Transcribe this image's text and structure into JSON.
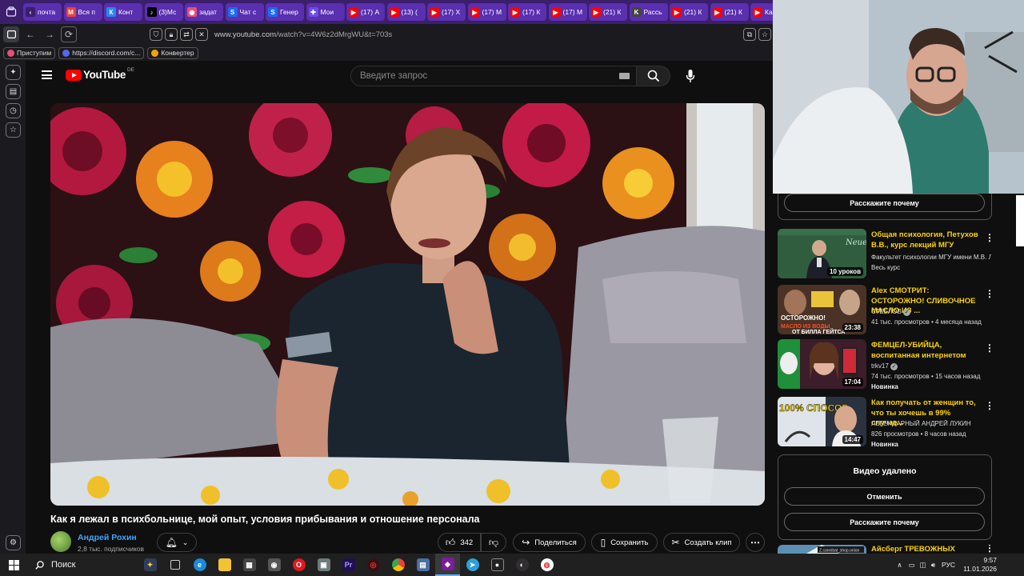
{
  "browser": {
    "tabs": [
      {
        "label": "почта",
        "icon": "chevron-left-icon",
        "color": "#3b1f6b"
      },
      {
        "label": "Вся п",
        "icon": "gmail-icon",
        "color": "#ea4335"
      },
      {
        "label": "Конт",
        "icon": "vk-icon",
        "color": "#2787f5"
      },
      {
        "label": "(3)Мс",
        "icon": "tiktok-icon",
        "color": "#000000"
      },
      {
        "label": "задат",
        "icon": "app-icon",
        "color": "#e94e77"
      },
      {
        "label": "Чат с",
        "icon": "s-icon",
        "color": "#1a6cf0"
      },
      {
        "label": "Генер",
        "icon": "s-icon",
        "color": "#1a6cf0"
      },
      {
        "label": "Мои",
        "icon": "plus-icon",
        "color": "#6b4de6"
      },
      {
        "label": "(17) А",
        "icon": "youtube-icon",
        "color": "#ff0000"
      },
      {
        "label": "(13) (",
        "icon": "youtube-icon",
        "color": "#ff0000"
      },
      {
        "label": "(17) Х",
        "icon": "youtube-icon",
        "color": "#ff0000"
      },
      {
        "label": "(17) М",
        "icon": "youtube-icon",
        "color": "#ff0000"
      },
      {
        "label": "(17) К",
        "icon": "youtube-icon",
        "color": "#ff0000"
      },
      {
        "label": "(17) М",
        "icon": "youtube-icon",
        "color": "#ff0000"
      },
      {
        "label": "(21) К",
        "icon": "youtube-icon",
        "color": "#ff0000"
      },
      {
        "label": "Рассь",
        "icon": "k-icon",
        "color": "#444444"
      },
      {
        "label": "(21) К",
        "icon": "youtube-icon",
        "color": "#ff0000"
      },
      {
        "label": "(21) К",
        "icon": "youtube-icon",
        "color": "#ff0000"
      },
      {
        "label": "Ка",
        "icon": "youtube-icon",
        "color": "#ff0000"
      }
    ],
    "url_domain": "www.youtube.com",
    "url_path": "/watch?v=4W6z2dMrgWU&t=703s",
    "bookmarks": [
      {
        "label": "Приступим",
        "color": "#e94e77"
      },
      {
        "label": "https://discord.com/c...",
        "color": "#5865f2"
      },
      {
        "label": "Конвертер",
        "color": "#f4a400"
      }
    ]
  },
  "youtube": {
    "logo_text": "YouTube",
    "region": "DE",
    "search_placeholder": "Введите запрос",
    "video_title": "Как я лежал в психбольнице, мой опыт, условия прибывания и отношение персонала",
    "channel_name": "Андрей Рохин",
    "subscribers": "2,8 тыс. подписчиков",
    "likes": "342",
    "share_label": "Поделиться",
    "save_label": "Сохранить",
    "clip_label": "Создать клип",
    "tell_why_label": "Расскажите почему",
    "recommendations": [
      {
        "title": "Общая психология, Петухов В.В., курс лекций МГУ",
        "channel": "Факультет психологии МГУ имени М.В. Ломоносова",
        "meta": "Весь курс",
        "duration": "10 уроков",
        "badge": ""
      },
      {
        "title": "Alex СМОТРИТ: ОСТОРОЖНО! СЛИВОЧНОЕ МАСЛО ИЗ ...",
        "channel": "СТЕБЛОВ",
        "meta": "41 тыс. просмотров • 4 месяца назад",
        "duration": "23:38",
        "badge": "",
        "thumb_caption": "ОСТОРОЖНО! МАСЛО ИЗ ВОДЫ ОТ БИЛЛА ГЕЙТСА"
      },
      {
        "title": "ФЕМЦЕЛ-УБИЙЦА, воспитанная интернетом",
        "channel": "trkv17",
        "meta": "74 тыс. просмотров • 15 часов назад",
        "duration": "17:04",
        "badge": "Новинка"
      },
      {
        "title": "Как получать от женщин то, что ты хочешь в 99% случае...",
        "channel": "ЛЕГЕНДАРНЫЙ АНДРЕЙ ЛУКИН",
        "meta": "826 просмотров • 8 часов назад",
        "duration": "14:47",
        "badge": "Новинка",
        "thumb_caption": "100% СПОСОБ"
      },
      {
        "title": "Айсберг ТРЕВОЖНЫХ",
        "channel": "",
        "meta": "",
        "duration": "",
        "badge": "",
        "thumb_caption": "Z.cannibal_shop.onion"
      }
    ],
    "deleted_title": "Видео удалено",
    "undo_label": "Отменить"
  },
  "taskbar": {
    "search_label": "Поиск",
    "language": "РУС",
    "time": "9:57",
    "date": "11.01.2026"
  }
}
